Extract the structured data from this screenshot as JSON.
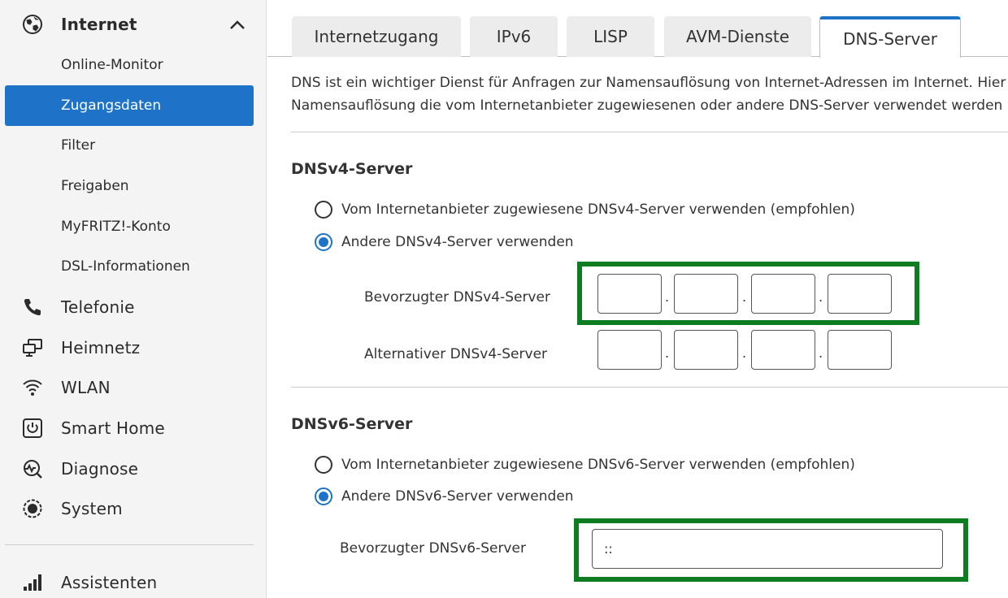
{
  "sidebar": {
    "internet": {
      "label": "Internet",
      "icon": "globe-icon",
      "expanded": true
    },
    "sub_items": [
      {
        "label": "Online-Monitor",
        "active": false
      },
      {
        "label": "Zugangsdaten",
        "active": true
      },
      {
        "label": "Filter",
        "active": false
      },
      {
        "label": "Freigaben",
        "active": false
      },
      {
        "label": "MyFRITZ!-Konto",
        "active": false
      },
      {
        "label": "DSL-Informationen",
        "active": false
      }
    ],
    "main_items": [
      {
        "label": "Telefonie",
        "icon": "phone-icon"
      },
      {
        "label": "Heimnetz",
        "icon": "network-icon"
      },
      {
        "label": "WLAN",
        "icon": "wifi-icon"
      },
      {
        "label": "Smart Home",
        "icon": "power-icon"
      },
      {
        "label": "Diagnose",
        "icon": "diagnose-icon"
      },
      {
        "label": "System",
        "icon": "system-icon"
      }
    ],
    "assistenten": {
      "label": "Assistenten",
      "icon": "signal-bars-icon"
    }
  },
  "tabs": [
    {
      "label": "Internetzugang",
      "active": false
    },
    {
      "label": "IPv6",
      "active": false
    },
    {
      "label": "LISP",
      "active": false
    },
    {
      "label": "AVM-Dienste",
      "active": false
    },
    {
      "label": "DNS-Server",
      "active": true
    }
  ],
  "intro": {
    "line1": "DNS ist ein wichtiger Dienst für Anfragen zur Namensauflösung von Internet-Adressen im Internet. Hier",
    "line2": "Namensauflösung die vom Internetanbieter zugewiesenen oder andere DNS-Server verwendet werden"
  },
  "dnsv4": {
    "title": "DNSv4-Server",
    "option_isp": "Vom Internetanbieter zugewiesene DNSv4-Server verwenden (empfohlen)",
    "option_other": "Andere DNSv4-Server verwenden",
    "selected": "other",
    "preferred_label": "Bevorzugter DNSv4-Server",
    "alternative_label": "Alternativer DNSv4-Server",
    "preferred_octets": [
      "",
      "",
      "",
      ""
    ],
    "alternative_octets": [
      "",
      "",
      "",
      ""
    ],
    "separator": "."
  },
  "dnsv6": {
    "title": "DNSv6-Server",
    "option_isp": "Vom Internetanbieter zugewiesene DNSv6-Server verwenden (empfohlen)",
    "option_other": "Andere DNSv6-Server verwenden",
    "selected": "other",
    "preferred_label": "Bevorzugter DNSv6-Server",
    "preferred_value": "::"
  },
  "colors": {
    "accent": "#1e73c8",
    "highlight": "#0e7d22",
    "sidebar_bg": "#f4f4f4"
  }
}
